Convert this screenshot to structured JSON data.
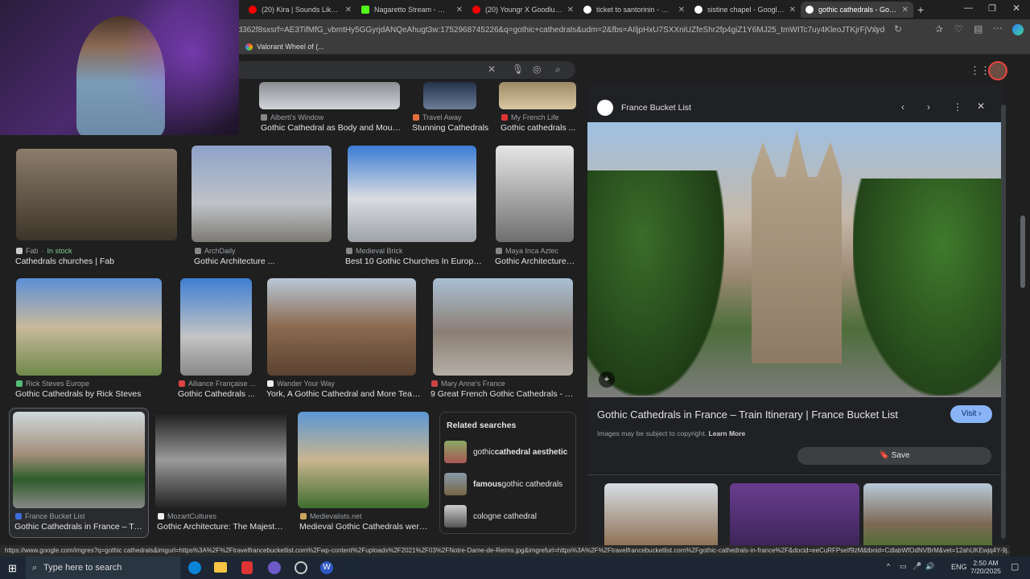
{
  "tabs": [
    {
      "title": "(20) Kira | Sounds Like ATL |",
      "color": "#ff0000"
    },
    {
      "title": "Nagaretto Stream - Watch",
      "color": "#53fc18"
    },
    {
      "title": "(20) Youngr X Goodluck - V",
      "color": "#ff0000"
    },
    {
      "title": "ticket to santorinin - Googl",
      "color": "#8ab4f8"
    },
    {
      "title": "sistine chapel - Google Sea",
      "color": "#8ab4f8"
    },
    {
      "title": "gothic cathedrals - Google",
      "color": "#8ab4f8"
    }
  ],
  "url": "7d362f8sxsrf=AE3TifMfG_vbmtHy5GGyrjdANQeAhugt3w:1752968745226&q=gothic+cathedrals&udm=2&fbs=AIljpHxU7SXXniUZfeShr2fp4giZ1Y6MJ25_tmWITc7uy4KleoJTKjrFjVxydQWql...",
  "bookmark": "Valorant Wheel of (...",
  "results_top": [
    {
      "source": "Alberti's Window",
      "caption": "Gothic Cathedral as Body and Mount..."
    },
    {
      "source": "Travel Away",
      "caption": "Stunning Cathedrals"
    },
    {
      "source": "My French Life",
      "caption": "Gothic cathedrals ..."
    }
  ],
  "row1": [
    {
      "source": "Fab",
      "badge": "In stock",
      "caption": "Cathedrals churches | Fab"
    },
    {
      "source": "ArchDaily",
      "caption": "Gothic Architecture ..."
    },
    {
      "source": "Medieval Brick",
      "caption": "Best 10 Gothic Churches In Europe ..."
    },
    {
      "source": "Maya Inca Aztec",
      "caption": "Gothic Architecture ..."
    }
  ],
  "row2": [
    {
      "source": "Rick Steves Europe",
      "caption": "Gothic Cathedrals by Rick Steves"
    },
    {
      "source": "Alliance Française ...",
      "caption": "Gothic Cathedrals ..."
    },
    {
      "source": "Wander Your Way",
      "caption": "York, A Gothic Cathedral and More Tears ..."
    },
    {
      "source": "Mary Anne's France",
      "caption": "9 Great French Gothic Cathedrals - Ma..."
    }
  ],
  "row3": [
    {
      "source": "France Bucket List",
      "caption": "Gothic Cathedrals in France – Trai..."
    },
    {
      "source": "MozartCultures",
      "caption": "Gothic Architecture: The Majesty o..."
    },
    {
      "source": "Medievalists.net",
      "caption": "Medieval Gothic Cathedrals were ..."
    }
  ],
  "related": {
    "title": "Related searches",
    "items": [
      {
        "pre": "gothic ",
        "bold": "cathedral aesthetic",
        "post": ""
      },
      {
        "pre": "",
        "bold": "famous",
        "post": " gothic cathedrals"
      },
      {
        "pre": "cologne cathedral",
        "bold": "",
        "post": ""
      }
    ]
  },
  "panel": {
    "source": "France Bucket List",
    "title": "Gothic Cathedrals in France – Train Itinerary | France Bucket List",
    "visit": "Visit",
    "copyright": "Images may be subject to copyright.",
    "learn_more": "Learn More",
    "save": "Save"
  },
  "status_url": "https://www.google.com/imgres?q=gothic cathedrals&imgurl=https%3A%2F%2Ftravelfrancebucketlist.com%2Fwp-content%2Fuploads%2F2021%2F03%2FNotre-Dame-de-Reims.jpg&imgrefurl=https%3A%2F%2Ftravelfrancebucketlist.com%2Fgothic-cathedrals-in-france%2F&docid=eeCuRFPseIf9zM&tbnid=CdlabWfOdNVBrM&vet=12ahUKEwjq4Y-9j...",
  "taskbar": {
    "search_placeholder": "Type here to search",
    "lang": "ENG",
    "time": "2:50 AM",
    "date": "7/20/2025"
  }
}
